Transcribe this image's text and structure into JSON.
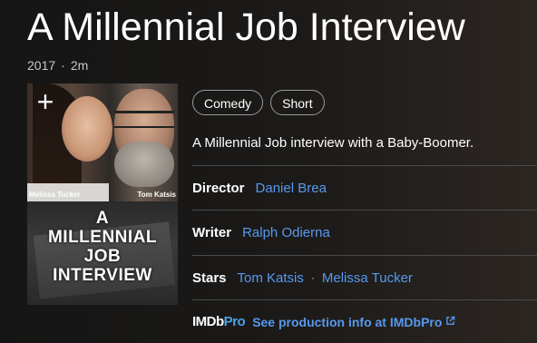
{
  "title": "A Millennial Job Interview",
  "meta": {
    "year": "2017",
    "separator": "·",
    "runtime": "2m"
  },
  "poster": {
    "add_icon": "+",
    "caption_left": "Melissa Tucker",
    "caption_right": "Tom Katsis",
    "title_lines": [
      "A",
      "MILLENNIAL",
      "JOB",
      "INTERVIEW"
    ]
  },
  "genres": [
    "Comedy",
    "Short"
  ],
  "plot": "A Millennial Job interview with a Baby-Boomer.",
  "credits": {
    "director_label": "Director",
    "director": "Daniel Brea",
    "writer_label": "Writer",
    "writer": "Ralph Odierna",
    "stars_label": "Stars",
    "stars": [
      "Tom Katsis",
      "Melissa Tucker"
    ],
    "stars_separator": "·"
  },
  "imdbpro": {
    "logo_a": "IMDb",
    "logo_b": "Pro",
    "link": "See production info at IMDbPro",
    "icon": "external-link-icon"
  },
  "colors": {
    "link": "#5799ef",
    "pro": "#4aa3e8"
  }
}
